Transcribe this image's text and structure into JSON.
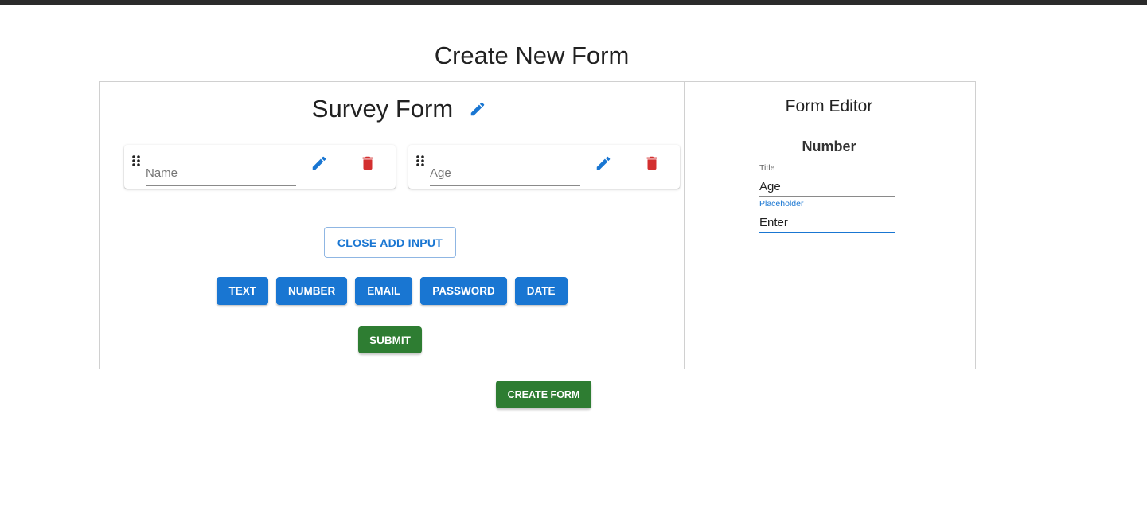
{
  "page": {
    "title": "Create New Form"
  },
  "builder": {
    "form_title": "Survey Form",
    "fields": [
      {
        "placeholder": "Name"
      },
      {
        "placeholder": "Age"
      }
    ],
    "close_add_input_label": "CLOSE ADD INPUT",
    "input_types": [
      "TEXT",
      "NUMBER",
      "EMAIL",
      "PASSWORD",
      "DATE"
    ],
    "submit_label": "SUBMIT"
  },
  "editor": {
    "heading": "Form Editor",
    "field_type": "Number",
    "title_label": "Title",
    "title_value": "Age",
    "placeholder_label": "Placeholder",
    "placeholder_value": "Enter"
  },
  "create_form_label": "CREATE FORM",
  "icons": {
    "title_edit": "pencil-icon",
    "field_drag": "drag-handle-icon",
    "field_edit": "pencil-icon",
    "field_delete": "trash-icon"
  },
  "colors": {
    "primary": "#1976d2",
    "success": "#2e7d32",
    "danger": "#d32f2f",
    "topbar": "#2b2b2b"
  }
}
